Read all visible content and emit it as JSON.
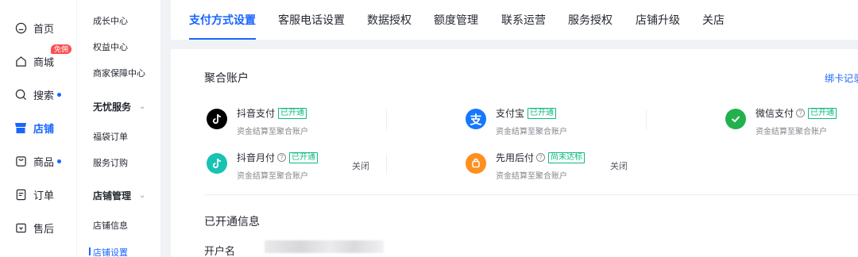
{
  "nav1": {
    "items": [
      {
        "label": "首页"
      },
      {
        "label": "商城",
        "badge": "免佣"
      },
      {
        "label": "搜索"
      },
      {
        "label": "店铺"
      },
      {
        "label": "商品"
      },
      {
        "label": "订单"
      },
      {
        "label": "售后"
      }
    ]
  },
  "nav2": {
    "growth": "成长中心",
    "rights": "权益中心",
    "guarantee": "商家保障中心",
    "worryfree_group": "无忧服务",
    "lucky_bag": "福袋订单",
    "service_order": "服务订购",
    "store_group": "店铺管理",
    "store_info": "店铺信息",
    "store_settings": "店铺设置"
  },
  "tabs": [
    "支付方式设置",
    "客服电话设置",
    "数据授权",
    "额度管理",
    "联系运营",
    "服务授权",
    "店铺升级",
    "关店"
  ],
  "main": {
    "aggregate_title": "聚合账户",
    "bind_card_link": "绑卡记录",
    "payments": {
      "douyin": {
        "name": "抖音支付",
        "status": "已开通",
        "desc": "资金结算至聚合账户"
      },
      "alipay": {
        "name": "支付宝",
        "status": "已开通",
        "desc": "资金结算至聚合账户"
      },
      "wechat": {
        "name": "微信支付",
        "status": "已开通",
        "desc": "资金结算至聚合账户"
      },
      "monthly": {
        "name": "抖音月付",
        "status": "已开通",
        "desc": "资金结算至聚合账户",
        "action": "关闭"
      },
      "paylater": {
        "name": "先用后付",
        "status": "尚未达标",
        "desc": "资金结算至聚合账户",
        "action": "关闭"
      }
    },
    "opened_info_title": "已开通信息",
    "account_name_label": "开户名"
  },
  "colors": {
    "accent": "#1966ff",
    "success": "#10b981",
    "alipay": "#1677ff",
    "wechat": "#23b14d",
    "paylater": "#ff8f1f",
    "badge": "#ff4d4f"
  }
}
